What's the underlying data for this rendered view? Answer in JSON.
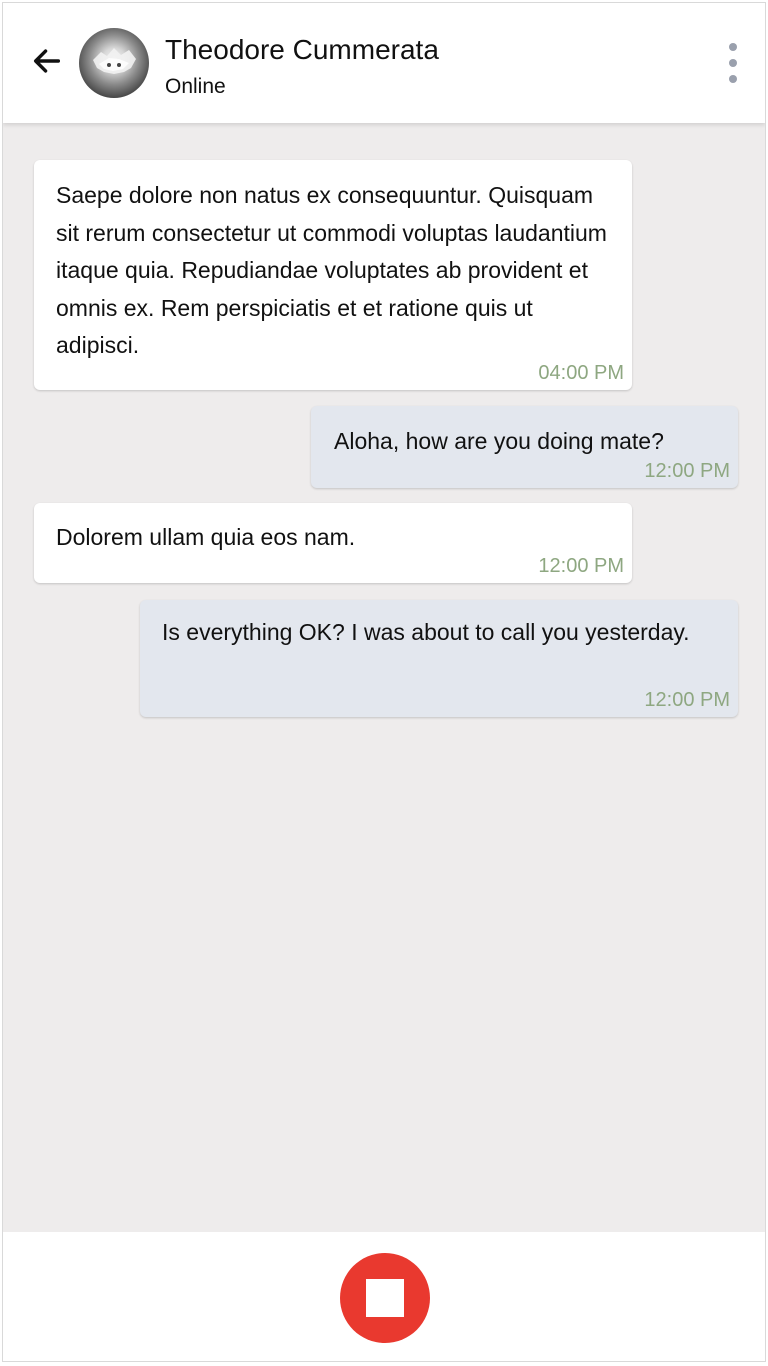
{
  "header": {
    "contact_name": "Theodore Cummerata",
    "status": "Online",
    "back_icon": "arrow-left-icon",
    "menu_icon": "more-vertical-icon"
  },
  "messages": [
    {
      "direction": "incoming",
      "text": "Saepe dolore non natus ex consequuntur. Quisquam sit rerum consectetur ut commodi voluptas laudantium itaque quia. Repudiandae voluptates ab provident et omnis ex. Rem perspiciatis et et ratione quis ut adipisci.",
      "time": "04:00 PM"
    },
    {
      "direction": "outgoing",
      "text": "Aloha, how are you doing mate?",
      "time": "12:00 PM"
    },
    {
      "direction": "incoming",
      "text": "Dolorem ullam quia eos nam.",
      "time": "12:00 PM"
    },
    {
      "direction": "outgoing",
      "text": "Is everything OK? I was about to call you yesterday.",
      "time": "12:00 PM"
    }
  ],
  "footer": {
    "record_icon": "stop-icon"
  },
  "colors": {
    "background": "#eeecec",
    "incoming_bubble": "#ffffff",
    "outgoing_bubble": "#e3e7ee",
    "timestamp": "#8ea781",
    "record_button": "#e9392f",
    "menu_dots": "#9aa0ad"
  }
}
